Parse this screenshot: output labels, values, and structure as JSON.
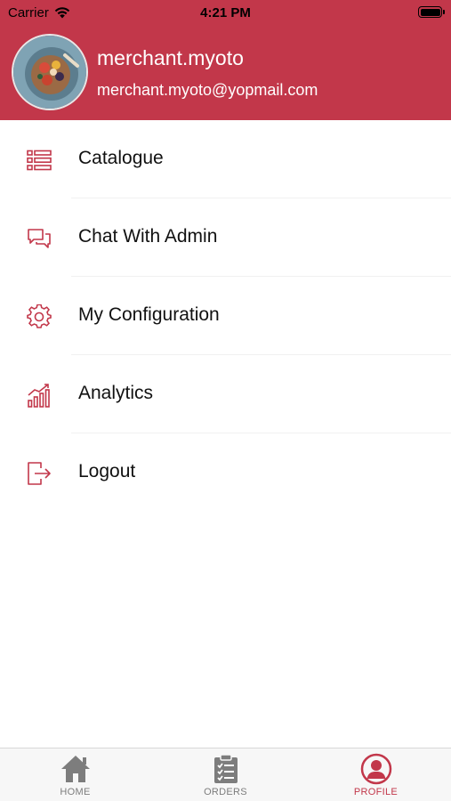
{
  "status_bar": {
    "carrier": "Carrier",
    "time": "4:21 PM"
  },
  "profile": {
    "username": "merchant.myoto",
    "email": "merchant.myoto@yopmail.com"
  },
  "menu": [
    {
      "label": "Catalogue",
      "icon": "catalogue-icon"
    },
    {
      "label": "Chat With Admin",
      "icon": "chat-icon"
    },
    {
      "label": "My Configuration",
      "icon": "gear-icon"
    },
    {
      "label": "Analytics",
      "icon": "analytics-icon"
    },
    {
      "label": "Logout",
      "icon": "logout-icon"
    }
  ],
  "tabs": [
    {
      "label": "HOME",
      "icon": "home-icon",
      "active": false
    },
    {
      "label": "ORDERS",
      "icon": "clipboard-icon",
      "active": false
    },
    {
      "label": "PROFILE",
      "icon": "profile-icon",
      "active": true
    }
  ],
  "colors": {
    "accent": "#c2374a",
    "tab_inactive": "#7d7d7d"
  }
}
